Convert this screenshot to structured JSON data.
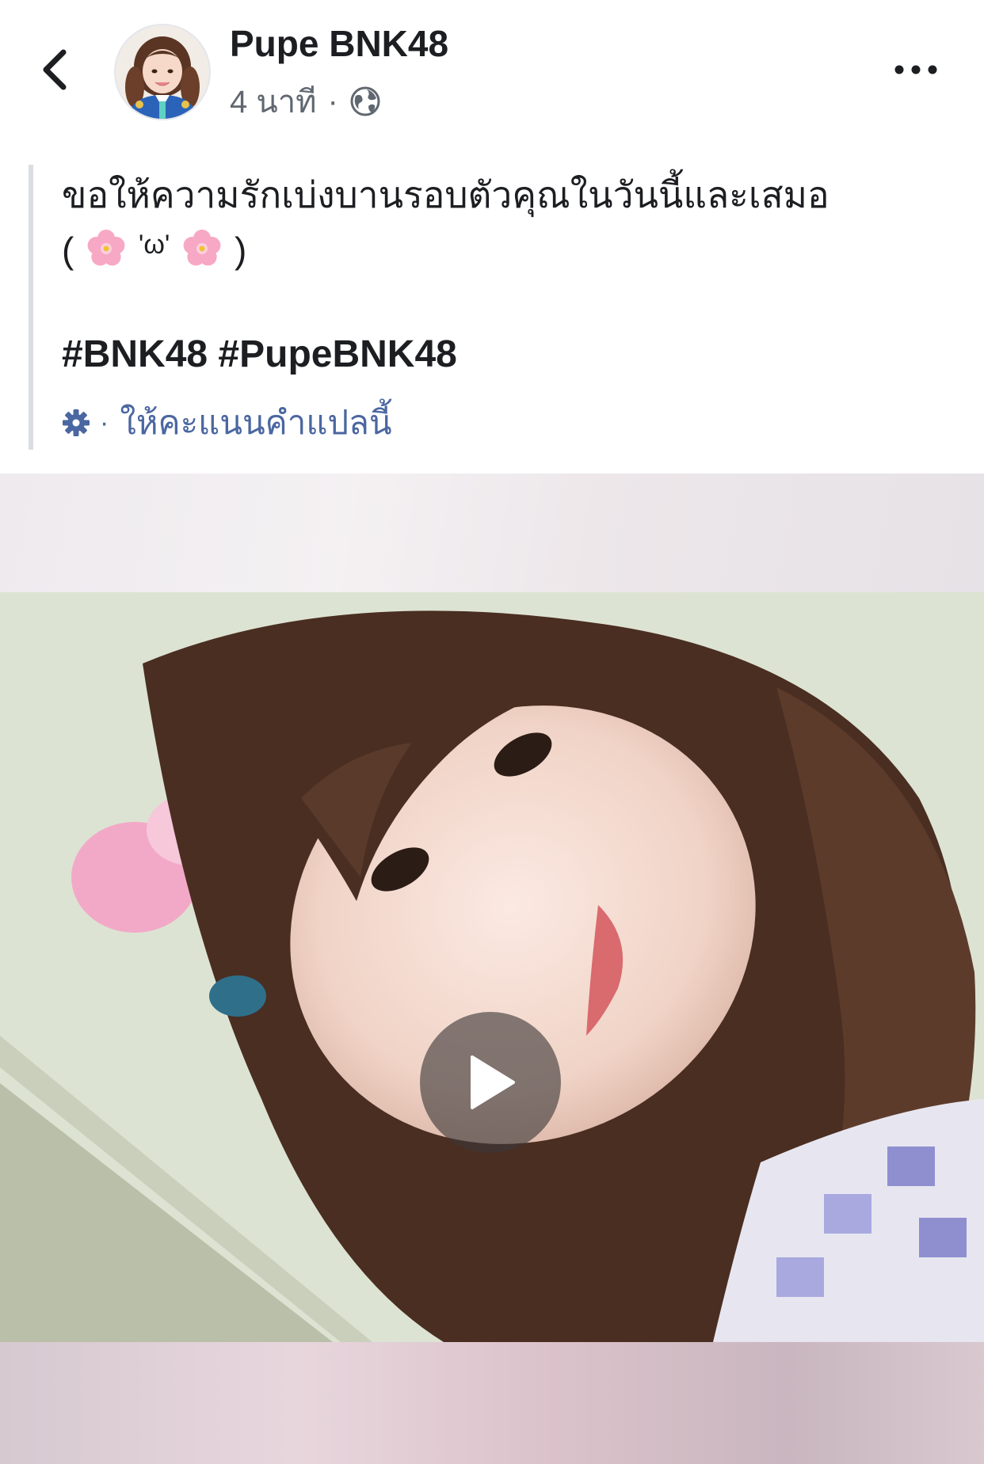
{
  "header": {
    "back_icon": "chevron-left-icon",
    "page_name": "Pupe BNK48",
    "timestamp": "4 นาที",
    "separator": "·",
    "privacy_icon": "globe-icon",
    "more_icon": "more-horizontal-icon"
  },
  "post": {
    "caption_line_1": "ขอให้ความรักเบ่งบานรอบตัวคุณในวันนี้และเสมอ",
    "caption_line_2_open": "(",
    "caption_line_2_mid": "'ω'",
    "caption_line_2_close": ")",
    "emoji_icon": "cherry-blossom-icon",
    "hashtags": "#BNK48 #PupeBNK48",
    "translate_separator": "·",
    "translate_label": "ให้คะแนนคำแปลนี้",
    "translate_icon": "gear-icon"
  },
  "video": {
    "play_icon": "play-icon"
  },
  "colors": {
    "text_primary": "#1c1e21",
    "text_secondary": "#606770",
    "link": "#4b67a1",
    "quote_border": "#dadde1"
  }
}
